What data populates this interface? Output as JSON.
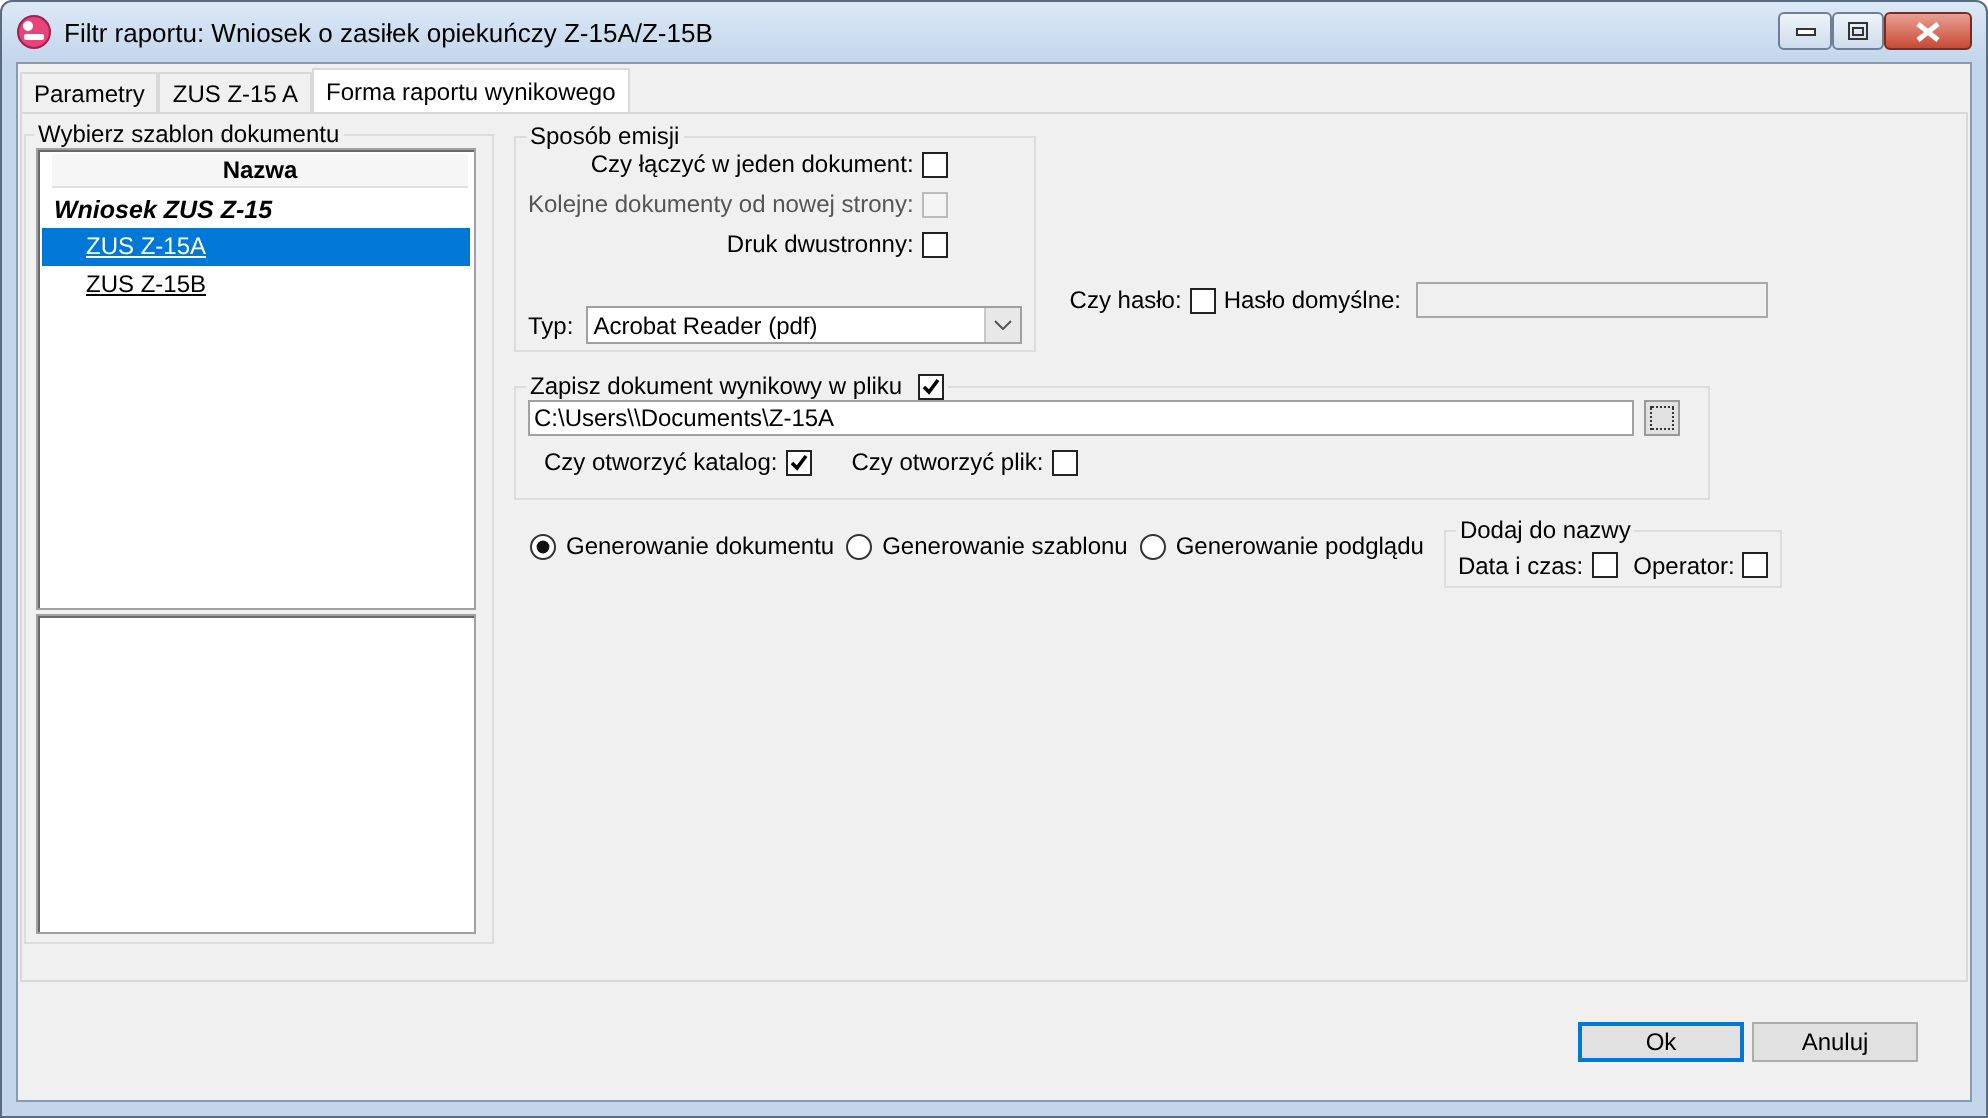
{
  "window": {
    "title": "Filtr raportu: Wniosek o zasiłek opiekuńczy Z-15A/Z-15B"
  },
  "tabs": [
    {
      "label": "Parametry",
      "selected": false
    },
    {
      "label": "ZUS Z-15 A",
      "selected": false
    },
    {
      "label": "Forma raportu wynikowego",
      "selected": true
    }
  ],
  "template_group": {
    "title": "Wybierz szablon dokumentu",
    "column": "Nazwa",
    "tree": [
      {
        "label": "Wniosek ZUS Z-15",
        "children": [
          {
            "label": "ZUS Z-15A",
            "selected": true
          },
          {
            "label": "ZUS Z-15B",
            "selected": false
          }
        ]
      }
    ]
  },
  "emission": {
    "title": "Sposób emisji",
    "options": [
      {
        "label": "Czy łączyć w jeden dokument:",
        "checked": false,
        "disabled": false
      },
      {
        "label": "Kolejne dokumenty od nowej strony:",
        "checked": false,
        "disabled": true
      },
      {
        "label": "Druk dwustronny:",
        "checked": false,
        "disabled": false
      }
    ],
    "type_label": "Typ:",
    "type_value": "Acrobat Reader (pdf)"
  },
  "password": {
    "label": "Czy hasło:",
    "checked": false,
    "default_label": "Hasło domyślne:"
  },
  "save": {
    "label": "Zapisz dokument wynikowy w pliku",
    "checked": true,
    "path": "C:\\Users\\\\Documents\\Z-15A",
    "open_folder": {
      "label": "Czy otworzyć katalog:",
      "checked": true
    },
    "open_file": {
      "label": "Czy otworzyć plik:",
      "checked": false
    }
  },
  "modes": [
    {
      "label": "Generowanie dokumentu",
      "selected": true
    },
    {
      "label": "Generowanie szablonu",
      "selected": false
    },
    {
      "label": "Generowanie podglądu",
      "selected": false
    }
  ],
  "name_suffix": {
    "title": "Dodaj do nazwy",
    "options": [
      {
        "label": "Data i czas:",
        "checked": false
      },
      {
        "label": "Operator:",
        "checked": false
      }
    ]
  },
  "buttons": [
    {
      "label": "Ok",
      "default": true
    },
    {
      "label": "Anuluj",
      "default": false
    }
  ]
}
